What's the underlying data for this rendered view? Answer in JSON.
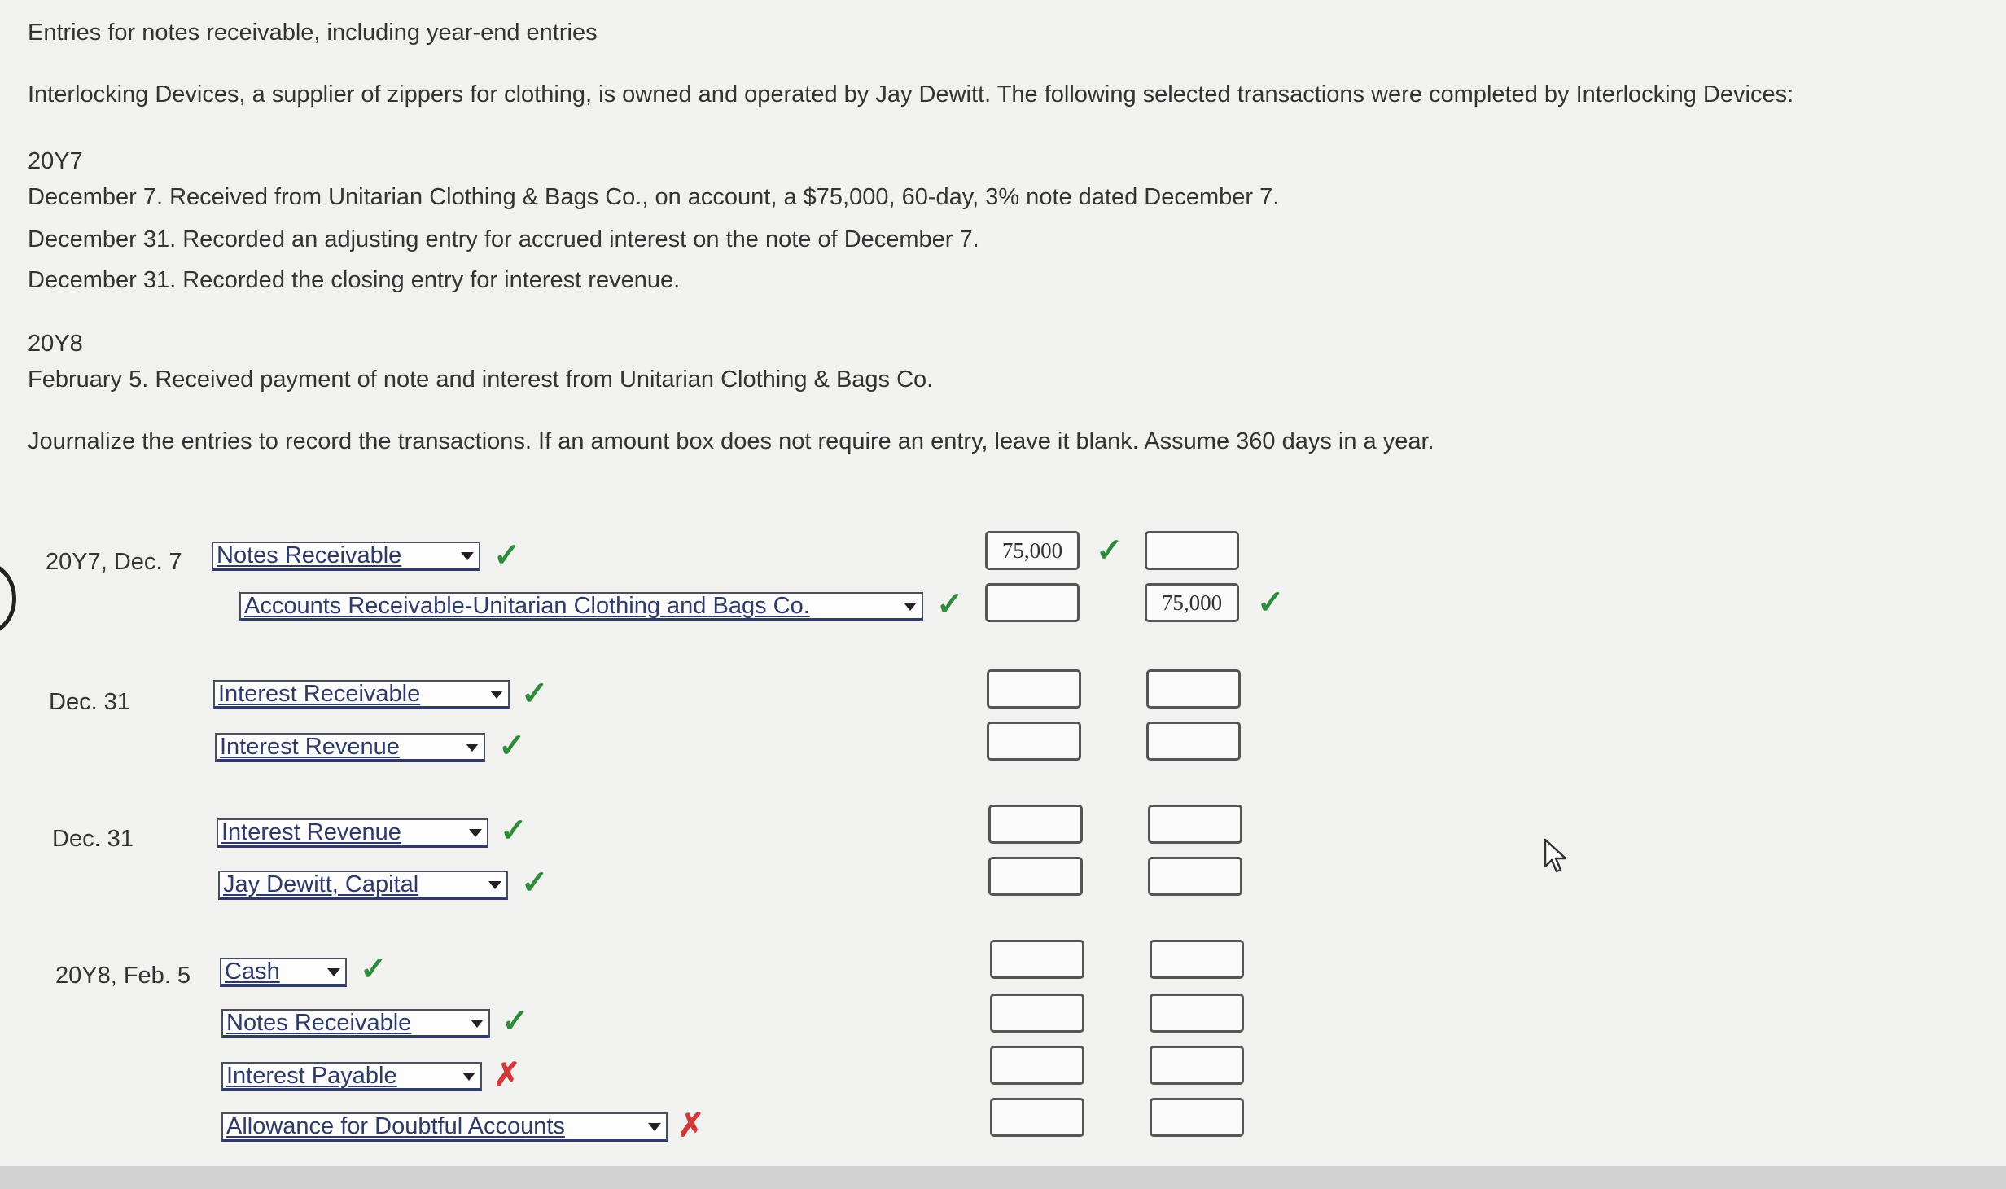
{
  "title": "Entries for notes receivable, including year-end entries",
  "intro": "Interlocking Devices, a supplier of zippers for clothing, is owned and operated by Jay Dewitt. The following selected transactions were completed by Interlocking Devices:",
  "year1": "20Y7",
  "t1": "December 7. Received from Unitarian Clothing & Bags Co., on account, a $75,000, 60-day, 3% note dated December 7.",
  "t2": "December 31. Recorded an adjusting entry for accrued interest on the note of December 7.",
  "t3": "December 31. Recorded the closing entry for interest revenue.",
  "year2": "20Y8",
  "t4": "February 5. Received payment of note and interest from Unitarian Clothing & Bags Co.",
  "instructions": "Journalize the entries to record the transactions. If an amount box does not require an entry, leave it blank. Assume 360 days in a year.",
  "journal": {
    "e1": {
      "date": "20Y7, Dec. 7",
      "debit_account": "Notes Receivable",
      "debit_amount": "75,000",
      "credit_account": "Accounts Receivable-Unitarian Clothing and Bags Co.",
      "credit_amount": "75,000"
    },
    "e2": {
      "date": "Dec. 31",
      "debit_account": "Interest Receivable",
      "credit_account": "Interest Revenue"
    },
    "e3": {
      "date": "Dec. 31",
      "debit_account": "Interest Revenue",
      "credit_account": "Jay Dewitt, Capital"
    },
    "e4": {
      "date": "20Y8, Feb. 5",
      "account1": "Cash",
      "account2": "Notes Receivable",
      "account3": "Interest Payable",
      "account4": "Allowance for Doubtful Accounts"
    }
  },
  "marks": {
    "correct": "✓",
    "incorrect": "✗"
  },
  "colors": {
    "correct": "#2f8a3c",
    "incorrect": "#d23a3a",
    "select_text": "#2f3a66"
  }
}
